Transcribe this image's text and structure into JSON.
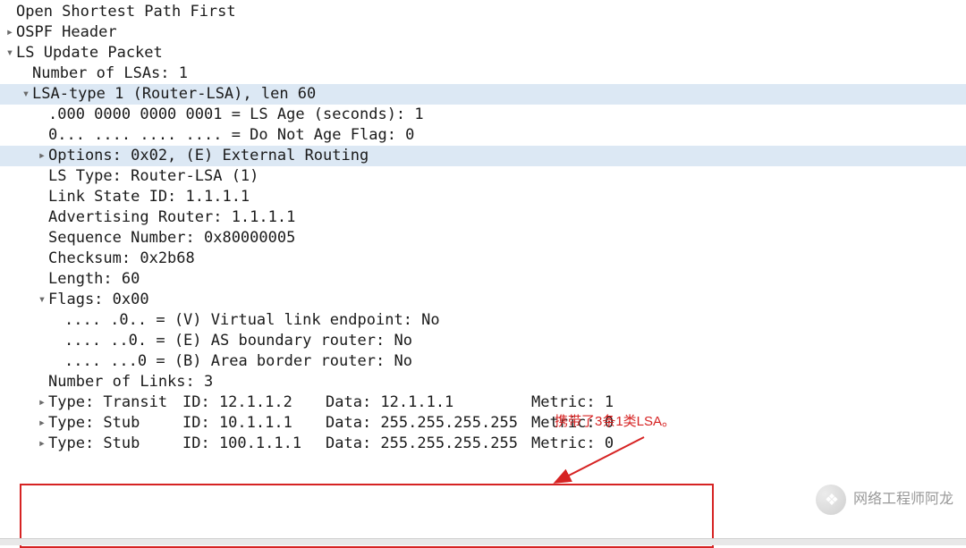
{
  "title": "Open Shortest Path First",
  "top": {
    "ospf_header": "OSPF Header",
    "ls_update": "LS Update Packet",
    "num_lsas": "Number of LSAs: 1",
    "lsa_type": "LSA-type 1 (Router-LSA), len 60",
    "ls_age": ".000 0000 0000 0001 = LS Age (seconds): 1",
    "dna": "0... .... .... .... = Do Not Age Flag: 0",
    "options": "Options: 0x02, (E) External Routing",
    "ls_type": "LS Type: Router-LSA (1)",
    "lsid": "Link State ID: 1.1.1.1",
    "advr": "Advertising Router: 1.1.1.1",
    "seq": "Sequence Number: 0x80000005",
    "cksum": "Checksum: 0x2b68",
    "len": "Length: 60",
    "flags": "Flags: 0x00",
    "fv": ".... .0.. = (V) Virtual link endpoint: No",
    "fe": ".... ..0. = (E) AS boundary router: No",
    "fb": ".... ...0 = (B) Area border router: No",
    "nlinks": "Number of Links: 3"
  },
  "links": [
    {
      "type": "Type: Transit",
      "id": "ID: 12.1.1.2",
      "data": "Data: 12.1.1.1",
      "metric": "Metric: 1"
    },
    {
      "type": "Type: Stub",
      "id": "ID: 10.1.1.1",
      "data": "Data: 255.255.255.255",
      "metric": "Metric: 0"
    },
    {
      "type": "Type: Stub",
      "id": "ID: 100.1.1.1",
      "data": "Data: 255.255.255.255",
      "metric": "Metric: 0"
    }
  ],
  "annotation": "携带了3条1类LSA。",
  "watermark": "网络工程师阿龙"
}
